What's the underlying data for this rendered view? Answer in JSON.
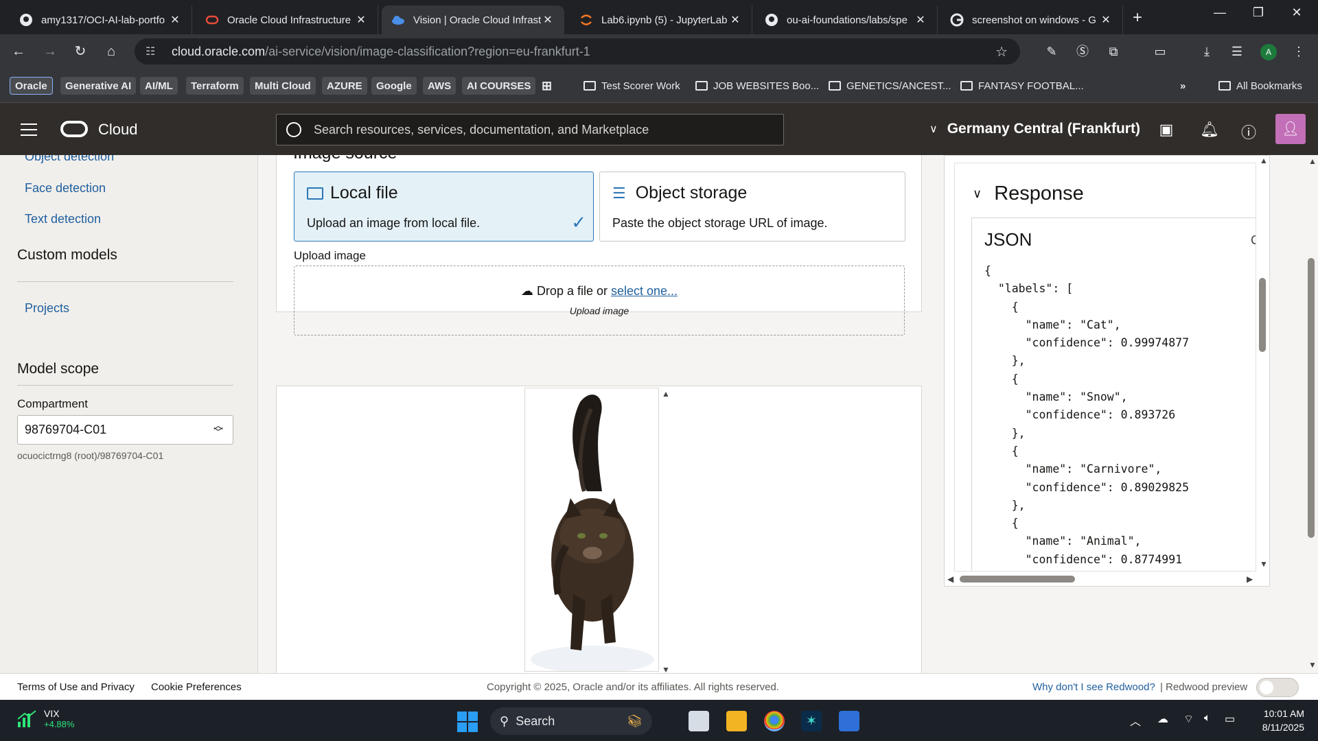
{
  "browser": {
    "tabs": [
      {
        "title": "amy1317/OCI-AI-lab-portfo",
        "icon": "github-icon"
      },
      {
        "title": "Oracle Cloud Infrastructure",
        "icon": "oracle-icon"
      },
      {
        "title": "Vision | Oracle Cloud Infrast",
        "icon": "oci-cloud-icon",
        "active": true
      },
      {
        "title": "Lab6.ipynb (5) - JupyterLab",
        "icon": "jupyter-icon"
      },
      {
        "title": "ou-ai-foundations/labs/spe",
        "icon": "github-icon"
      },
      {
        "title": "screenshot on windows - G",
        "icon": "google-icon"
      }
    ],
    "url_host": "cloud.oracle.com",
    "url_path": "/ai-service/vision/image-classification?region=eu-frankfurt-1",
    "bookmarks": [
      "Oracle",
      "Generative AI",
      "AI/ML",
      "Terraform",
      "Multi Cloud",
      "AZURE",
      "Google",
      "AWS",
      "AI COURSES"
    ],
    "bookmark_folders": [
      "Test Scorer Work",
      "JOB WEBSITES Boo...",
      "GENETICS/ANCEST...",
      "FANTASY FOOTBAL..."
    ],
    "all_bookmarks": "All Bookmarks",
    "profile_initial": "A"
  },
  "oci": {
    "brand": "Cloud",
    "search_placeholder": "Search resources, services, documentation, and Marketplace",
    "region": "Germany Central (Frankfurt)"
  },
  "sidebar": {
    "links": [
      "Object detection",
      "Face detection",
      "Text detection"
    ],
    "custom_models_heading": "Custom models",
    "projects_link": "Projects",
    "model_scope_heading": "Model scope",
    "compartment_label": "Compartment",
    "compartment_value": "98769704-C01",
    "compartment_path": "ocuocictrng8 (root)/98769704-C01"
  },
  "main": {
    "image_source_title": "Image source",
    "local_file_title": "Local file",
    "local_file_desc": "Upload an image from local file.",
    "object_storage_title": "Object storage",
    "object_storage_desc": "Paste the object storage URL of image.",
    "upload_label": "Upload image",
    "drop_text": "Drop a file or",
    "select_link": "select one...",
    "drop_sub": "Upload image"
  },
  "response": {
    "title": "Response",
    "json_label": "JSON",
    "json_text": "{\n  \"labels\": [\n    {\n      \"name\": \"Cat\",\n      \"confidence\": 0.99974877\n    },\n    {\n      \"name\": \"Snow\",\n      \"confidence\": 0.893726\n    },\n    {\n      \"name\": \"Carnivore\",\n      \"confidence\": 0.89029825\n    },\n    {\n      \"name\": \"Animal\",\n      \"confidence\": 0.8774991\n    }"
  },
  "footer": {
    "terms": "Terms of Use and Privacy",
    "cookies": "Cookie Preferences",
    "copyright": "Copyright © 2025, Oracle and/or its affiliates. All rights reserved.",
    "why_redwood": "Why don't I see Redwood?",
    "separator": "|",
    "redwood_preview": "Redwood preview"
  },
  "taskbar": {
    "ticker": "VIX",
    "ticker_change": "+4.88%",
    "search_label": "Search",
    "time": "10:01 AM",
    "date": "8/11/2025"
  }
}
